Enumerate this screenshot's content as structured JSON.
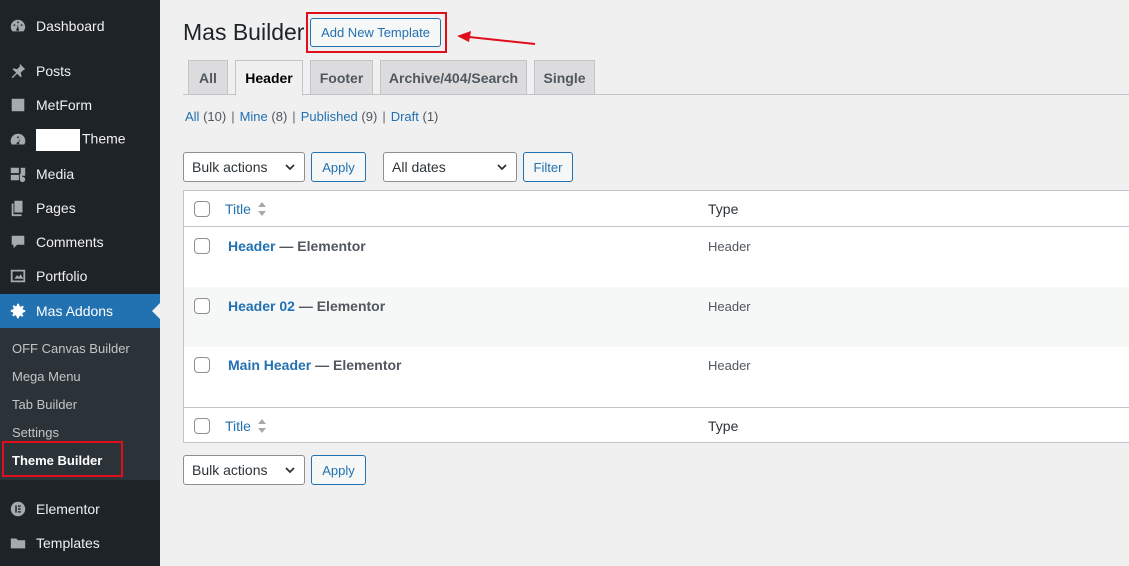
{
  "sidebar": {
    "items": [
      {
        "label": "Dashboard",
        "icon": "dashboard-icon"
      },
      {
        "label": "Posts",
        "icon": "pin-icon"
      },
      {
        "label": "MetForm",
        "icon": "form-icon"
      },
      {
        "label": "Theme",
        "icon": "gauge-icon"
      },
      {
        "label": "Media",
        "icon": "media-icon"
      },
      {
        "label": "Pages",
        "icon": "pages-icon"
      },
      {
        "label": "Comments",
        "icon": "comment-icon"
      },
      {
        "label": "Portfolio",
        "icon": "portfolio-icon"
      },
      {
        "label": "Mas Addons",
        "icon": "gear-icon"
      },
      {
        "label": "Elementor",
        "icon": "elementor-icon"
      },
      {
        "label": "Templates",
        "icon": "folder-icon"
      }
    ],
    "submenu": [
      "OFF Canvas Builder",
      "Mega Menu",
      "Tab Builder",
      "Settings",
      "Theme Builder"
    ]
  },
  "header": {
    "title": "Mas Builder",
    "add_new_label": "Add New Template"
  },
  "tabs": [
    "All",
    "Header",
    "Footer",
    "Archive/404/Search",
    "Single"
  ],
  "filters": {
    "all": "All",
    "all_count": "(10)",
    "mine": "Mine",
    "mine_count": "(8)",
    "published": "Published",
    "published_count": "(9)",
    "draft": "Draft",
    "draft_count": "(1)",
    "sep": "|"
  },
  "toolbar": {
    "bulk_actions": "Bulk actions",
    "apply": "Apply",
    "all_dates": "All dates",
    "filter": "Filter"
  },
  "table": {
    "col_title": "Title",
    "col_type": "Type",
    "rows": [
      {
        "title": "Header",
        "suffix": " — Elementor",
        "type": "Header"
      },
      {
        "title": "Header 02",
        "suffix": " — Elementor",
        "type": "Header"
      },
      {
        "title": "Main Header",
        "suffix": " — Elementor",
        "type": "Header"
      }
    ]
  },
  "colors": {
    "accent": "#2271b1",
    "sidebar": "#1d2327",
    "highlight": "#e00d1b"
  }
}
